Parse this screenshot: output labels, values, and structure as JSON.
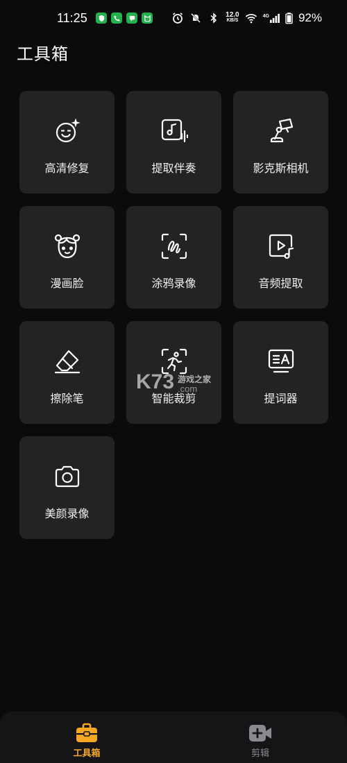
{
  "status_bar": {
    "time": "11:25",
    "net_speed_value": "12.0",
    "net_speed_unit": "KB/S",
    "signal_tag": "4G",
    "battery": "92%",
    "notification_icons": [
      "shield-icon",
      "phone-icon",
      "message-icon",
      "cat-icon"
    ]
  },
  "header": {
    "title": "工具箱"
  },
  "tools": [
    {
      "label": "高清修复",
      "icon": "face-sparkle-icon"
    },
    {
      "label": "提取伴奏",
      "icon": "music-extract-icon"
    },
    {
      "label": "影克斯相机",
      "icon": "desk-lamp-icon"
    },
    {
      "label": "漫画脸",
      "icon": "cartoon-face-icon"
    },
    {
      "label": "涂鸦录像",
      "icon": "doodle-icon"
    },
    {
      "label": "音频提取",
      "icon": "video-music-icon"
    },
    {
      "label": "擦除笔",
      "icon": "eraser-icon"
    },
    {
      "label": "智能裁剪",
      "icon": "smart-crop-icon"
    },
    {
      "label": "提词器",
      "icon": "teleprompter-icon"
    },
    {
      "label": "美颜录像",
      "icon": "camera-icon"
    }
  ],
  "watermark": {
    "brand": "K73",
    "text": "游戏之家",
    "domain": ".com"
  },
  "bottom_nav": {
    "items": [
      {
        "label": "工具箱",
        "icon": "toolbox-icon",
        "active": true
      },
      {
        "label": "剪辑",
        "icon": "video-add-icon",
        "active": false
      }
    ]
  },
  "colors": {
    "background": "#0b0b0c",
    "card": "#232326",
    "accent": "#f5a623",
    "inactive": "#8a8a8e"
  }
}
